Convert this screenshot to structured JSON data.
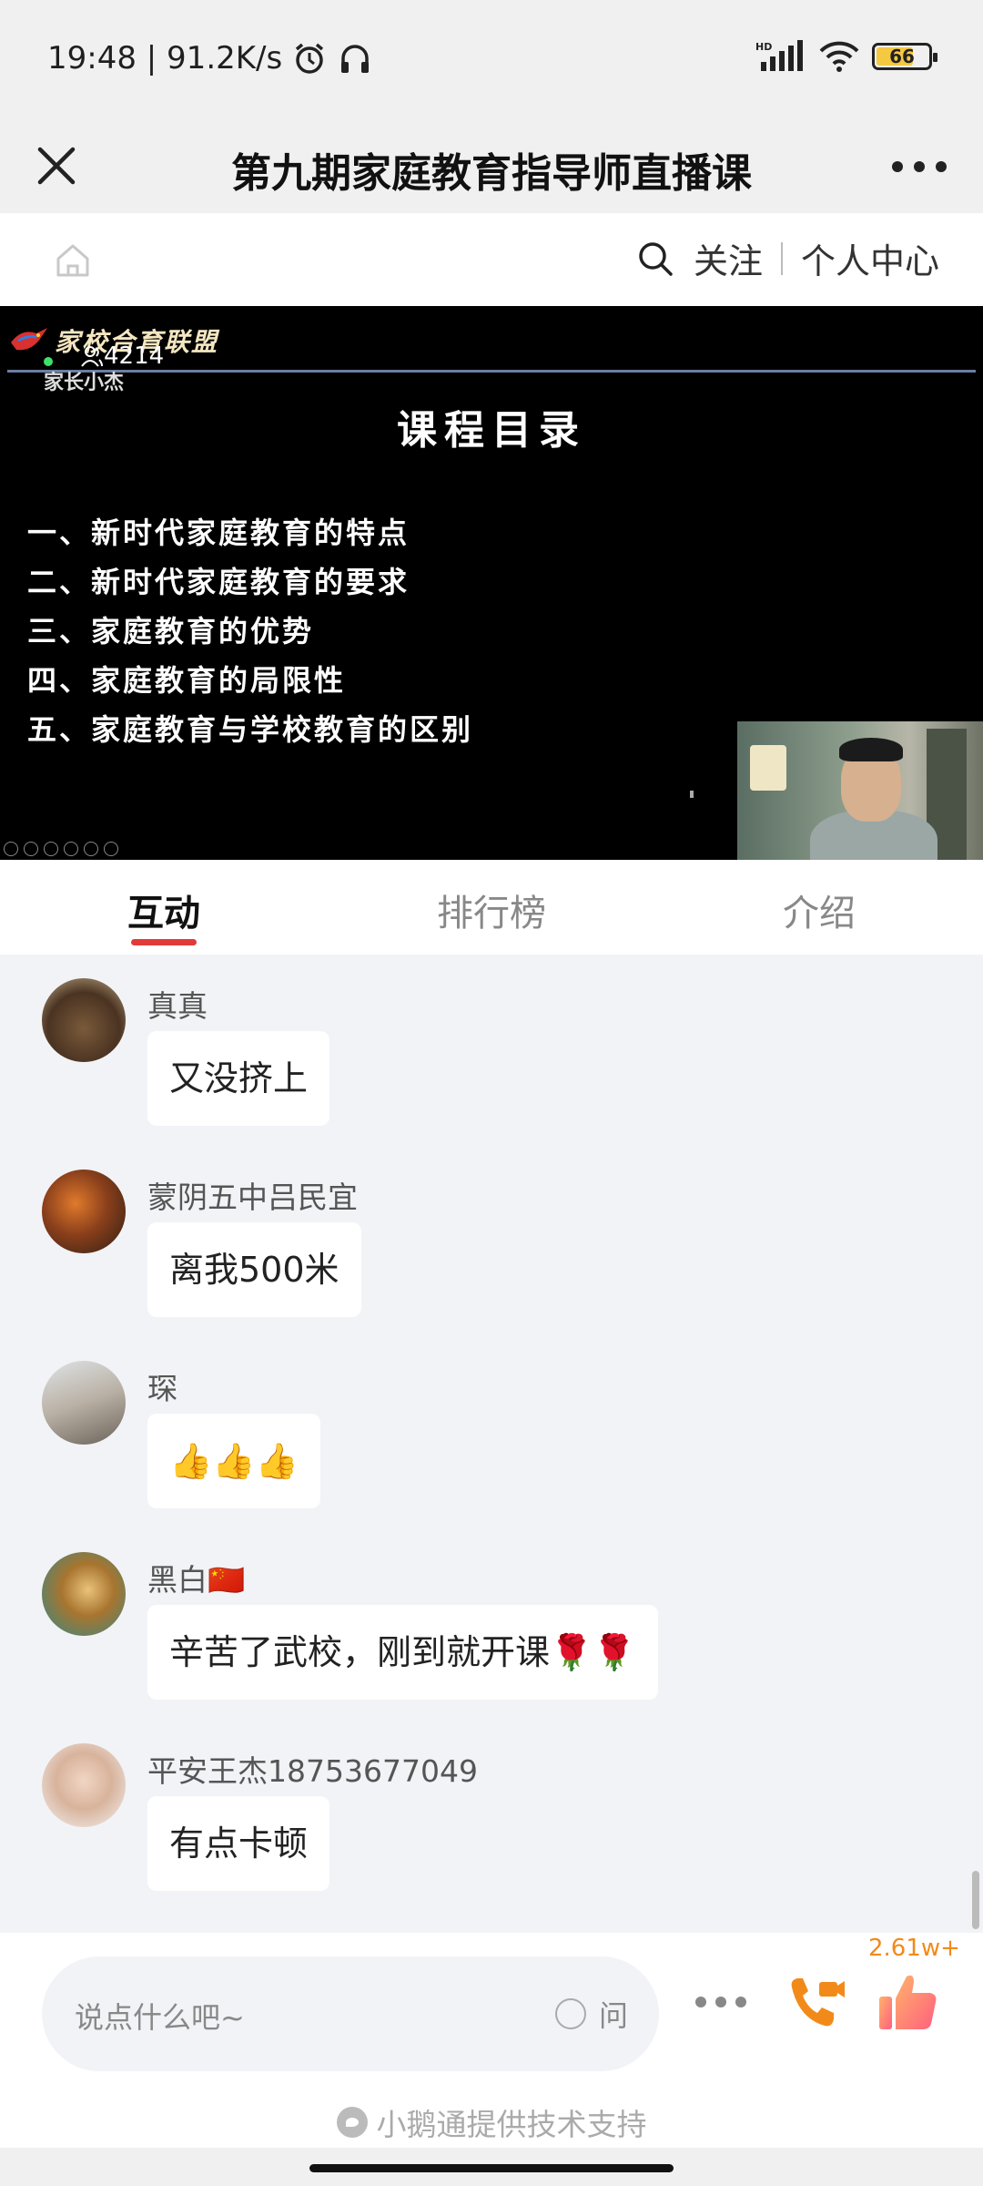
{
  "status_bar": {
    "time_speed": "19:48 | 91.2K/s",
    "battery": "66",
    "icons": [
      "alarm-icon",
      "headphones-icon",
      "hd-signal-icon",
      "wifi-icon",
      "battery-icon"
    ]
  },
  "title_bar": {
    "title": "第九期家庭教育指导师直播课"
  },
  "nav": {
    "follow": "关注",
    "personal_center": "个人中心"
  },
  "video": {
    "logo_text": "家校合育联盟",
    "viewer_count": "4214",
    "source_label": "家长小杰",
    "slide": {
      "title": "课程目录",
      "items": [
        "一、新时代家庭教育的特点",
        "二、新时代家庭教育的要求",
        "三、家庭教育的优势",
        "四、家庭教育的局限性",
        "五、家庭教育与学校教育的区别"
      ]
    }
  },
  "tabs": [
    {
      "label": "互动",
      "active": true
    },
    {
      "label": "排行榜",
      "active": false
    },
    {
      "label": "介绍",
      "active": false
    }
  ],
  "messages": [
    {
      "user": "真真",
      "text": "又没挤上"
    },
    {
      "user": "蒙阴五中吕民宜",
      "text": "离我500米"
    },
    {
      "user": "琛",
      "text": "👍👍👍"
    },
    {
      "user": "黑白🇨🇳",
      "text": "辛苦了武校，刚到就开课🌹🌹"
    },
    {
      "user": "平安王杰18753677049",
      "text": "有点卡顿"
    }
  ],
  "bottom": {
    "input_placeholder": "说点什么吧~",
    "ask_label": "问",
    "like_count": "2.61w+",
    "powered_by": "小鹅通提供技术支持"
  },
  "colors": {
    "accent_red": "#e23a3a",
    "like_orange": "#f28a1a",
    "chat_bg": "#f2f3f7"
  }
}
